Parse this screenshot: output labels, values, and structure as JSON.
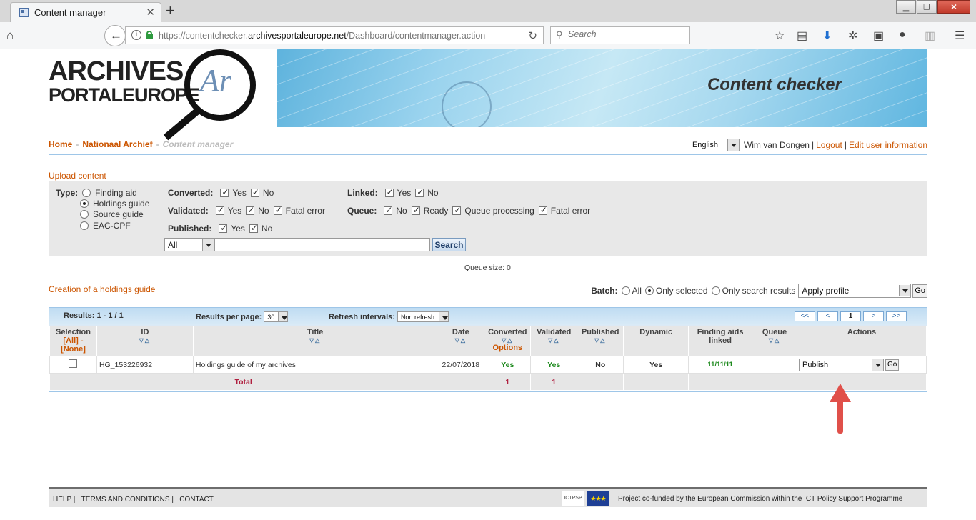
{
  "browser": {
    "tab_title": "Content manager",
    "url_prefix": "https://contentchecker.",
    "url_domain": "archivesportaleurope.net",
    "url_path": "/Dashboard/contentmanager.action",
    "search_placeholder": "Search"
  },
  "header": {
    "logo_line1": "ARCHIVES",
    "logo_line2": "PORTALEUROPE",
    "logo_mark": "Ar",
    "banner_title": "Content checker"
  },
  "breadcrumb": {
    "home": "Home",
    "archive": "Nationaal Archief",
    "current": "Content manager"
  },
  "userbar": {
    "language": "English",
    "username": "Wim van Dongen",
    "logout": "Logout",
    "edit_user": "Edit user information"
  },
  "upload": {
    "label": "Upload content"
  },
  "filters": {
    "type_label": "Type:",
    "types": [
      "Finding aid",
      "Holdings guide",
      "Source guide",
      "EAC-CPF"
    ],
    "converted_label": "Converted:",
    "validated_label": "Validated:",
    "published_label": "Published:",
    "linked_label": "Linked:",
    "queue_label": "Queue:",
    "yes": "Yes",
    "no": "No",
    "fatal_error": "Fatal error",
    "ready": "Ready",
    "queue_processing": "Queue processing",
    "scope_select": "All",
    "search_value": "",
    "search_button": "Search"
  },
  "queue": {
    "size_text": "Queue size: 0"
  },
  "creation": {
    "label": "Creation of a holdings guide"
  },
  "batch": {
    "label": "Batch:",
    "all": "All",
    "only_selected": "Only selected",
    "only_search": "Only search results",
    "profile": "Apply profile",
    "go": "Go"
  },
  "results": {
    "summary": "Results: 1 - 1 / 1",
    "per_page_label": "Results per page:",
    "per_page": "30",
    "refresh_label": "Refresh intervals:",
    "refresh": "Non refresh",
    "pager": {
      "first": "<<",
      "prev": "<",
      "page": "1",
      "next": ">",
      "last": ">>"
    }
  },
  "table": {
    "headers": {
      "selection": "Selection",
      "sel_all": "[All]",
      "sel_dash": " - ",
      "sel_none": "[None]",
      "id": "ID",
      "title": "Title",
      "date": "Date",
      "converted": "Converted",
      "options": "Options",
      "validated": "Validated",
      "published": "Published",
      "dynamic": "Dynamic",
      "finding_aids": "Finding aids linked",
      "queue": "Queue",
      "actions": "Actions"
    },
    "row": {
      "id": "HG_153226932",
      "title": "Holdings guide of my archives",
      "date": "22/07/2018",
      "converted": "Yes",
      "validated": "Yes",
      "published": "No",
      "dynamic": "Yes",
      "finding_aids": "11/11/11",
      "queue": "",
      "action": "Publish",
      "go": "Go"
    },
    "total": {
      "label": "Total",
      "converted": "1",
      "validated": "1"
    }
  },
  "footer": {
    "help": "HELP |",
    "terms": "TERMS AND CONDITIONS |",
    "contact": "CONTACT",
    "ict_logo": "ICTPSP",
    "funding": "Project co-funded by the European Commission within the ICT Policy Support Programme"
  },
  "colors": {
    "link_orange": "#cc5500",
    "green_yes": "#1e8a1e",
    "annotation_arrow": "#e0504a"
  }
}
